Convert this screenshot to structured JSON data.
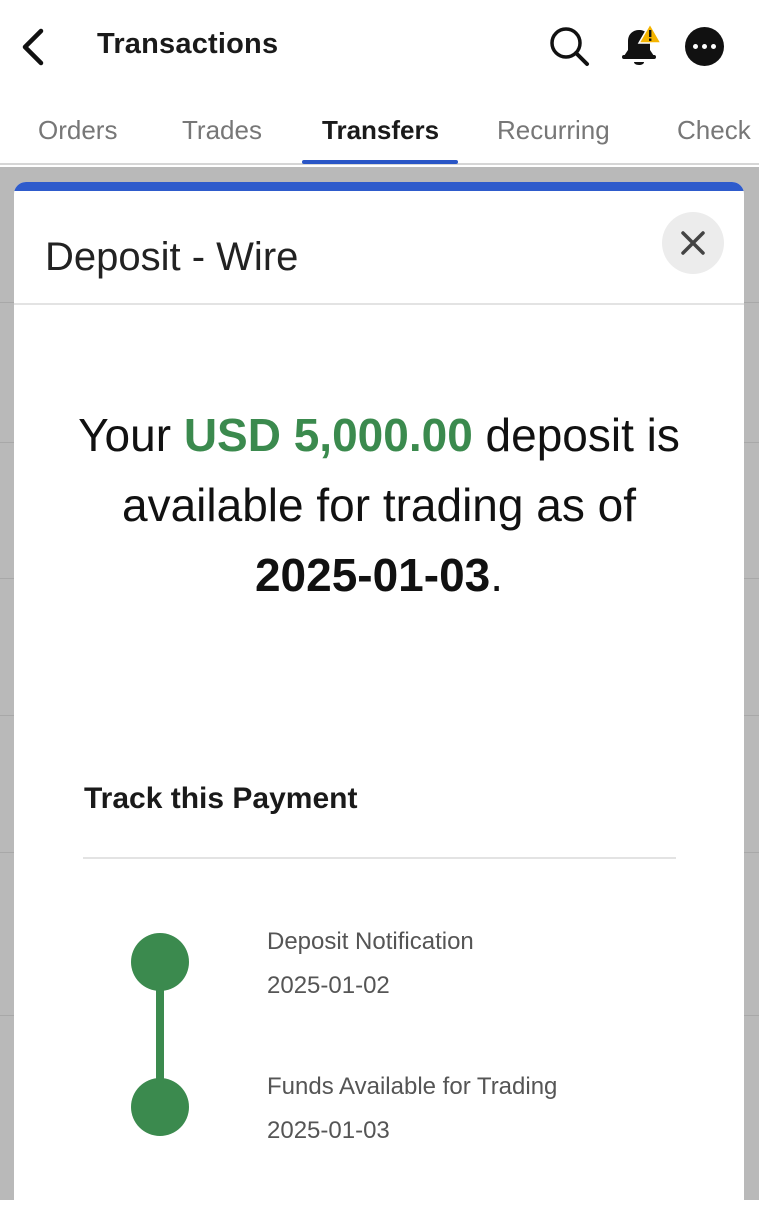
{
  "header": {
    "title": "Transactions",
    "back_icon": "chevron-left-icon",
    "search_icon": "search-icon",
    "notification_icon": "bell-alert-icon",
    "more_icon": "more-dots-icon"
  },
  "tabs": [
    {
      "label": "Orders",
      "active": false
    },
    {
      "label": "Trades",
      "active": false
    },
    {
      "label": "Transfers",
      "active": true
    },
    {
      "label": "Recurring",
      "active": false
    },
    {
      "label": "Check",
      "active": false
    }
  ],
  "modal": {
    "title": "Deposit - Wire",
    "close_icon": "close-icon",
    "message": {
      "prefix": "Your ",
      "amount": "USD 5,000.00",
      "middle": " deposit is available for trading as of ",
      "date": "2025-01-03",
      "suffix": "."
    },
    "track": {
      "title": "Track this Payment",
      "steps": [
        {
          "label": "Deposit Notification",
          "date": "2025-01-02"
        },
        {
          "label": "Funds Available for Trading",
          "date": "2025-01-03"
        }
      ]
    }
  },
  "colors": {
    "accent_blue": "#2e5bcc",
    "success_green": "#3b8a4e",
    "alert_yellow": "#f4b400"
  }
}
